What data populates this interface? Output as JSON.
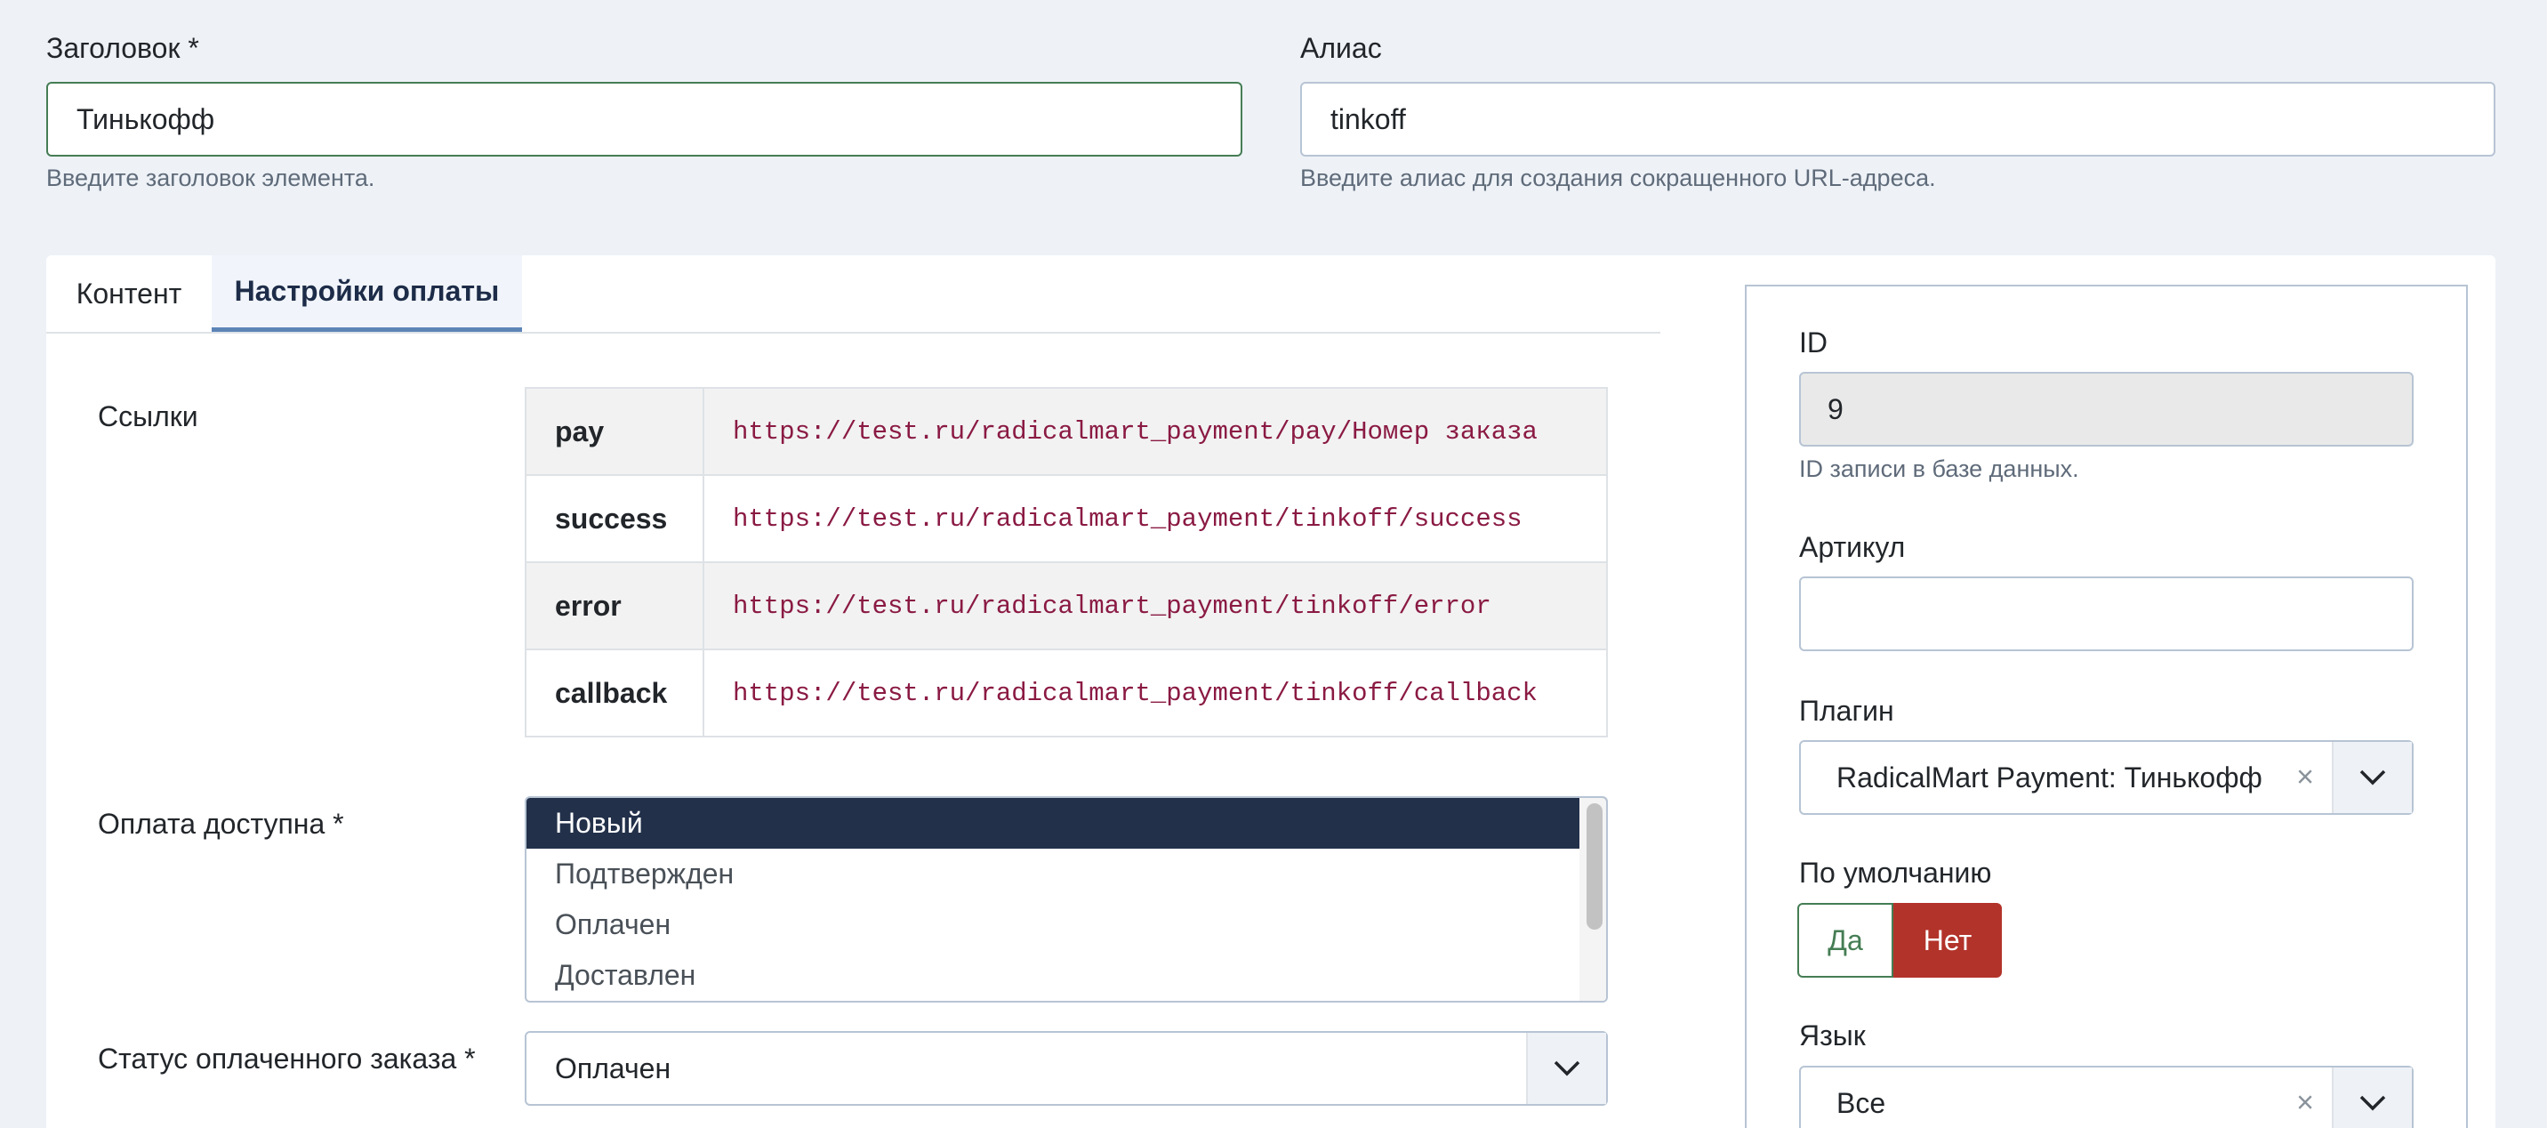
{
  "title_field": {
    "label": "Заголовок *",
    "value": "Тинькофф",
    "hint": "Введите заголовок элемента."
  },
  "alias_field": {
    "label": "Алиас",
    "value": "tinkoff",
    "hint": "Введите алиас для создания сокращенного URL-адреса."
  },
  "tabs": [
    {
      "label": "Контент",
      "active": false
    },
    {
      "label": "Настройки оплаты",
      "active": true
    }
  ],
  "links": {
    "label": "Ссылки",
    "rows": [
      {
        "key": "pay",
        "url": "https://test.ru/radicalmart_payment/pay/Номер заказа"
      },
      {
        "key": "success",
        "url": "https://test.ru/radicalmart_payment/tinkoff/success"
      },
      {
        "key": "error",
        "url": "https://test.ru/radicalmart_payment/tinkoff/error"
      },
      {
        "key": "callback",
        "url": "https://test.ru/radicalmart_payment/tinkoff/callback"
      }
    ]
  },
  "payment_available": {
    "label": "Оплата доступна *",
    "options": [
      {
        "label": "Новый",
        "selected": true
      },
      {
        "label": "Подтвержден",
        "selected": false
      },
      {
        "label": "Оплачен",
        "selected": false
      },
      {
        "label": "Доставлен",
        "selected": false
      }
    ]
  },
  "paid_status": {
    "label": "Статус оплаченного заказа *",
    "value": "Оплачен"
  },
  "sidebar": {
    "id": {
      "label": "ID",
      "value": "9",
      "hint": "ID записи в базе данных."
    },
    "sku": {
      "label": "Артикул",
      "value": ""
    },
    "plugin": {
      "label": "Плагин",
      "value": "RadicalMart Payment: Тинькофф",
      "clear": "×"
    },
    "default": {
      "label": "По умолчанию",
      "yes": "Да",
      "no": "Нет",
      "value": "no"
    },
    "language": {
      "label": "Язык",
      "value": "Все",
      "clear": "×"
    }
  },
  "colors": {
    "accent": "#5d84b7",
    "danger": "#b2332a",
    "success": "#457d54",
    "selected_bg": "#22304a"
  }
}
